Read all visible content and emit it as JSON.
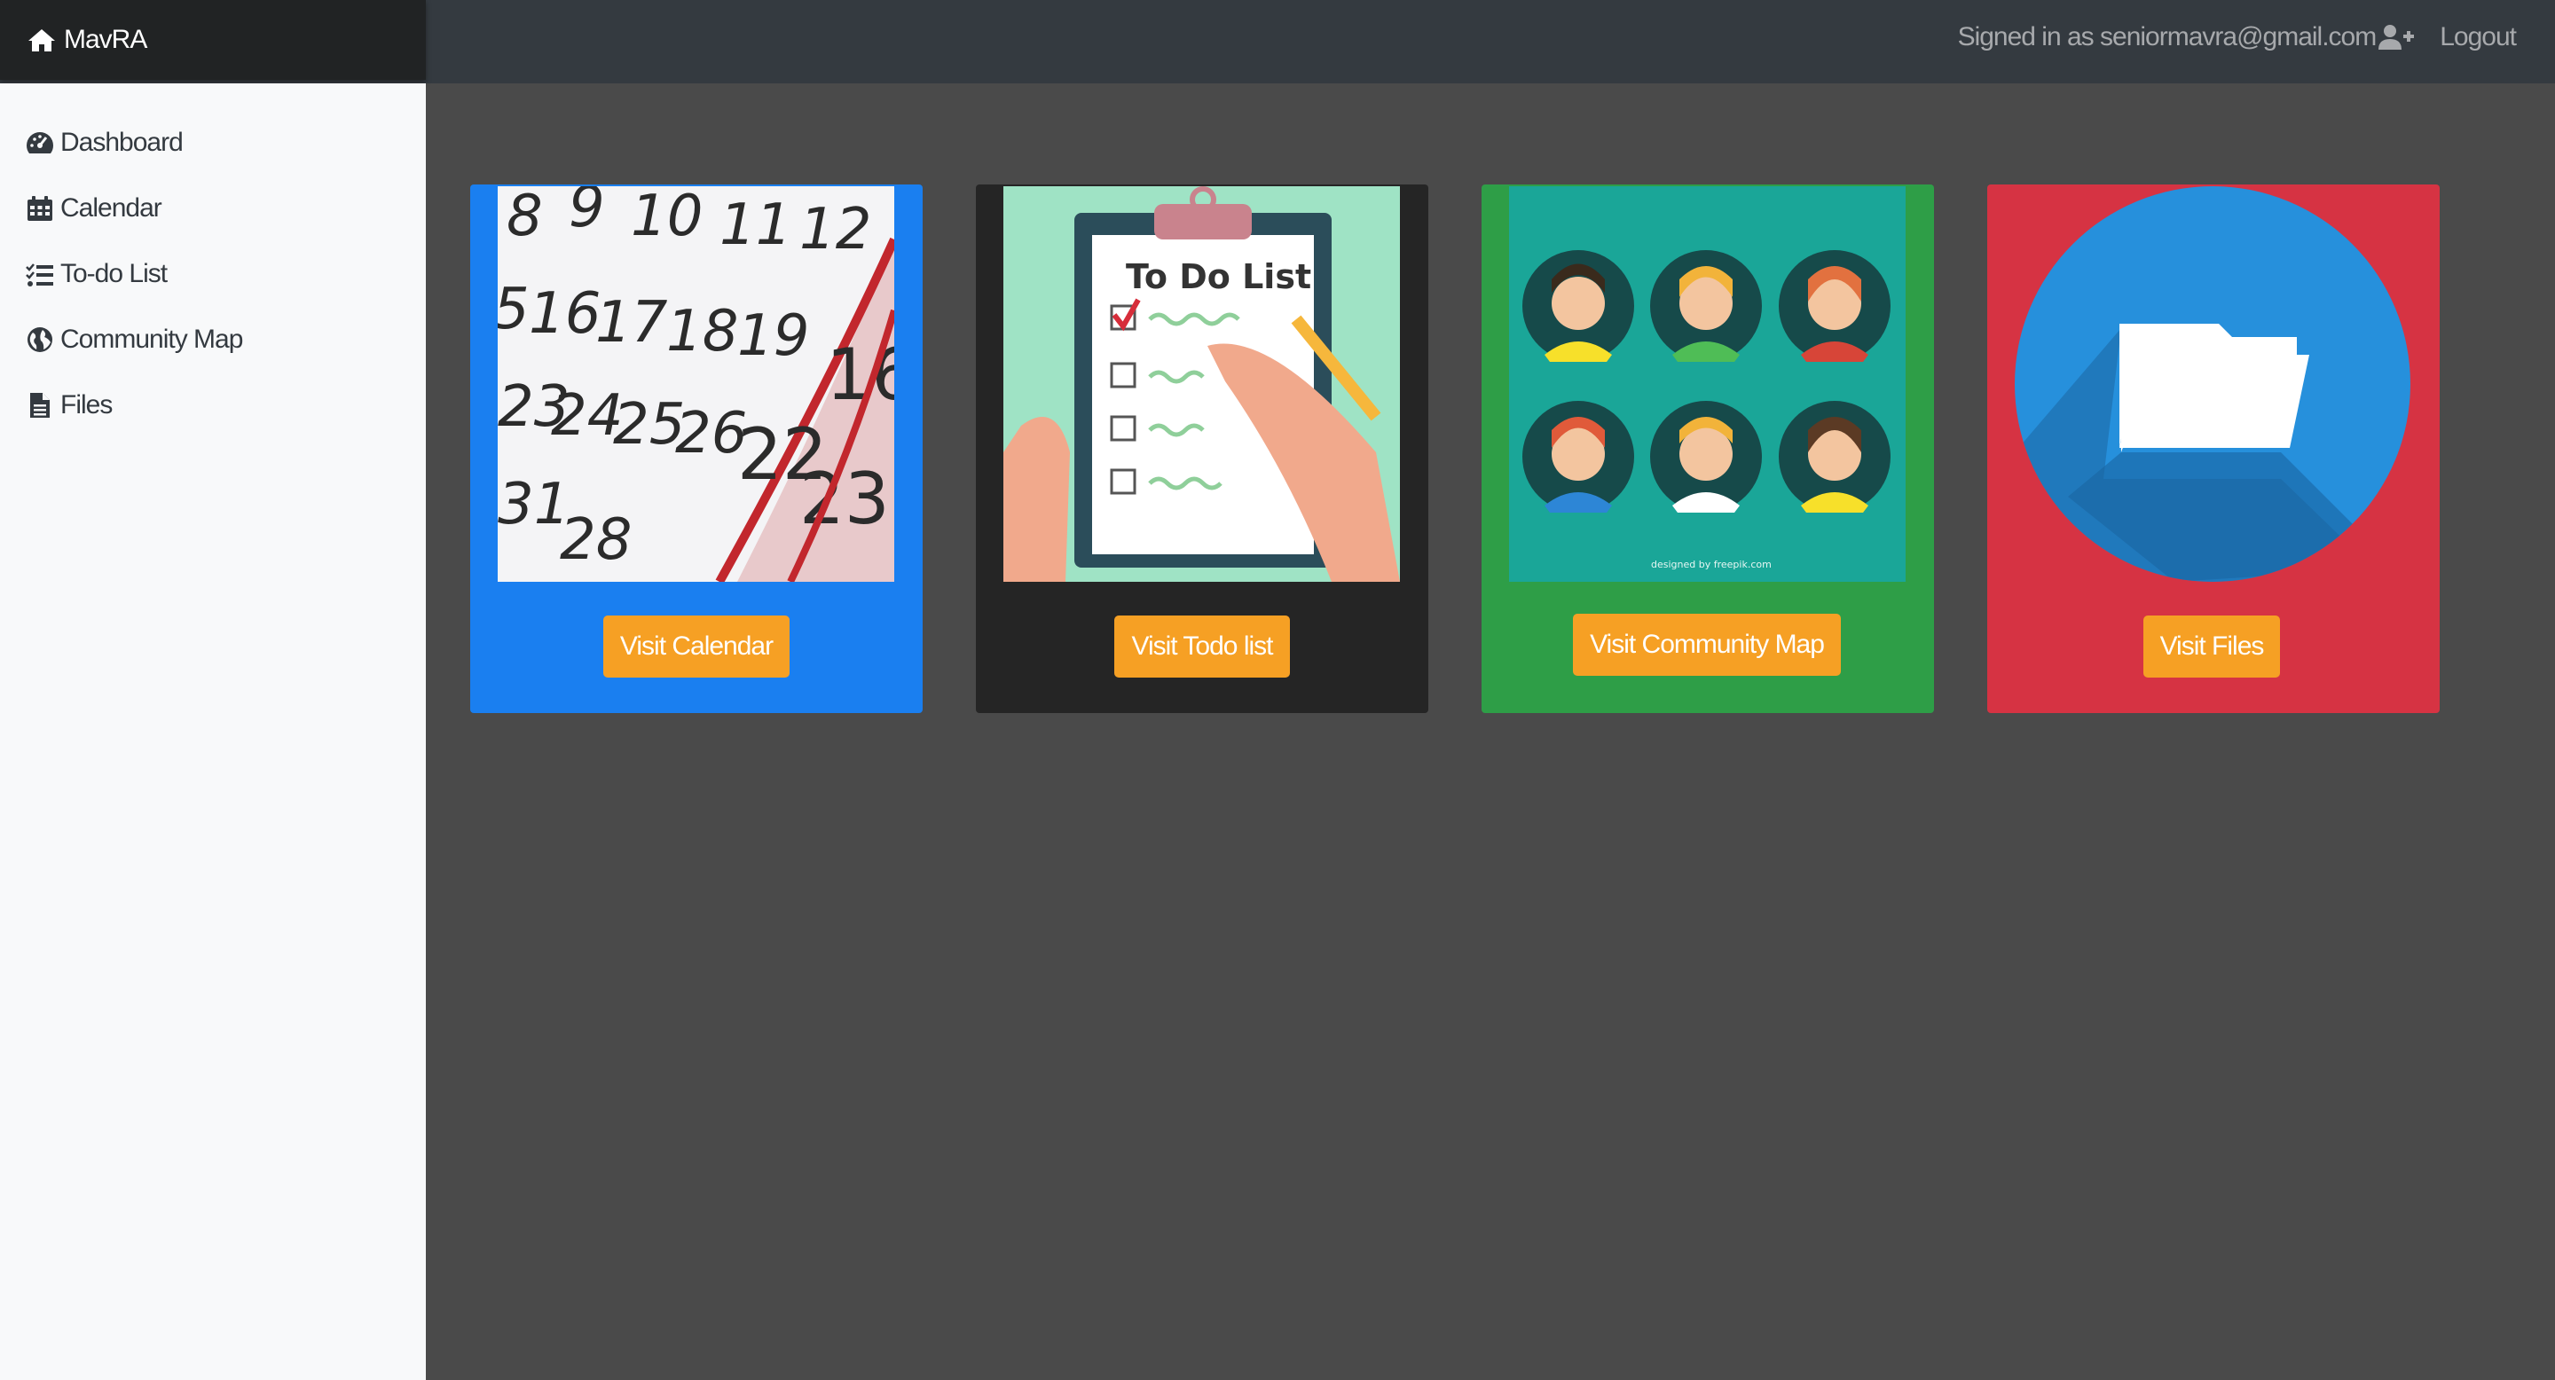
{
  "navbar": {
    "brand": "MavRA",
    "signed_in_text": "Signed in as seniormavra@gmail.com",
    "logout": "Logout"
  },
  "sidebar": {
    "items": [
      {
        "label": "Dashboard",
        "icon": "tachometer-icon"
      },
      {
        "label": "Calendar",
        "icon": "calendar-icon"
      },
      {
        "label": "To-do List",
        "icon": "tasks-icon"
      },
      {
        "label": "Community Map",
        "icon": "globe-icon"
      },
      {
        "label": "Files",
        "icon": "file-icon"
      }
    ]
  },
  "cards": [
    {
      "button": "Visit Calendar",
      "image": "calendar-image",
      "color": "#1a7ff0"
    },
    {
      "button": "Visit Todo list",
      "image": "todo-list-image",
      "color": "#252525",
      "image_title": "To Do List"
    },
    {
      "button": "Visit Community Map",
      "image": "community-avatars-image",
      "color": "#2e9e47",
      "credit": "designed by freepik.com"
    },
    {
      "button": "Visit Files",
      "image": "folder-image",
      "color": "#d63343"
    }
  ],
  "colors": {
    "accent_button": "#f6a024",
    "navbar": "#343a40",
    "background": "#4a4a4a"
  }
}
